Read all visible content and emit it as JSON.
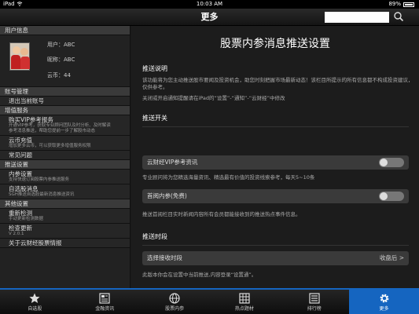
{
  "status_bar": {
    "device": "iPad",
    "wifi": "wifi-icon",
    "time": "10:03 AM",
    "battery": "89%"
  },
  "nav": {
    "title": "更多",
    "search_placeholder": "",
    "search_icon": "search-icon"
  },
  "sidebar": {
    "user_header": "用户信息",
    "user": {
      "username": "用户：ABC",
      "nickname": "昵称：ABC",
      "coins": "云币：44"
    },
    "account_header": "账号管理",
    "logout": "退出当前账号",
    "vip_header": "增值服务",
    "buy_vip": {
      "title": "购买VIP参考报务",
      "sub1": "开通VIP参考，获取专业顾问团队及时分析、及时解读",
      "sub2": "参考消息推送，帮助您提前一步了解股市动态"
    },
    "cloud_recharge": {
      "title": "云币充值",
      "sub": "增加更多云币，可以获取更多增值服务权限"
    },
    "faq": "常见问题",
    "push_header": "推送设置",
    "internal_ref": {
      "title": "内参设置",
      "sub": "支持快速订阅股票内参推送服务"
    },
    "auto_stock": {
      "title": "自选股消息",
      "sub": "SGH推送自选股最新消息推送资讯"
    },
    "other_header": "其他设置",
    "refresh": {
      "title": "重新检测",
      "sub": "手动更新检测数据"
    },
    "check_update": {
      "title": "检查更新",
      "sub": "V 2.0.1"
    },
    "about": "关于云财经股票情报"
  },
  "main": {
    "title": "股票内参消息推送设置",
    "push_desc_label": "推送说明",
    "push_desc": "该功能将为您主动推送股市要闻及投资机会，助您时刻把握市场最新动态！该栏目所提示的所有信息都不构成投资建议，仅供参考。",
    "push_note": "关闭或开启通知提醒请在iPad的“设置”-“通知”-“云财经”中修改",
    "switch_label": "推送开关",
    "vip_toggle": "云财经VIP参考资讯",
    "vip_toggle_desc": "专业顾问将为您精选海量资讯、精选最有价值的投资线索参考，每天5~10条",
    "free_toggle": "首阅内参(免费)",
    "free_toggle_desc": "推送首阅栏目实时新闻内容所有会员都能接收到的推送热点事件信息。",
    "time_label": "推送时段",
    "time_row": "选择接收时段",
    "time_value": "收盘后",
    "time_desc": "此版本你会在设置中当前推送,内容登录“设置通”。"
  },
  "tabs": [
    {
      "label": "自选股",
      "icon": "star-icon"
    },
    {
      "label": "金融资讯",
      "icon": "news-icon"
    },
    {
      "label": "股票内参",
      "icon": "globe-icon"
    },
    {
      "label": "热点题材",
      "icon": "grid-icon"
    },
    {
      "label": "排行榜",
      "icon": "list-icon"
    },
    {
      "label": "更多",
      "icon": "gear-icon",
      "active": true
    }
  ],
  "colors": {
    "accent": "#1565c0"
  }
}
